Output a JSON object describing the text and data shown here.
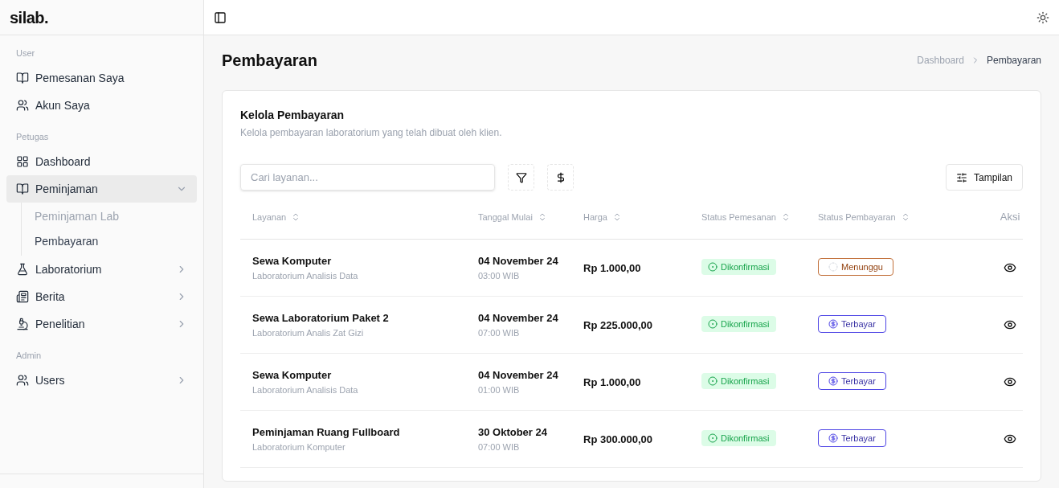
{
  "logo": "silab.",
  "sidebar": {
    "sections": [
      {
        "label": "User",
        "items": [
          {
            "label": "Pemesanan Saya",
            "selected": false
          },
          {
            "label": "Akun Saya",
            "selected": false
          }
        ]
      },
      {
        "label": "Petugas",
        "items": [
          {
            "label": "Dashboard",
            "selected": false
          },
          {
            "label": "Peminjaman",
            "selected": true,
            "expanded": true,
            "children": [
              {
                "label": "Peminjaman Lab",
                "selected": false
              },
              {
                "label": "Pembayaran",
                "selected": true
              }
            ]
          },
          {
            "label": "Laboratorium",
            "selected": false,
            "expanded": false
          },
          {
            "label": "Berita",
            "selected": false,
            "expanded": false
          },
          {
            "label": "Penelitian",
            "selected": false,
            "expanded": false
          }
        ]
      },
      {
        "label": "Admin",
        "items": [
          {
            "label": "Users",
            "selected": false,
            "expanded": false
          }
        ]
      }
    ]
  },
  "page": {
    "title": "Pembayaran",
    "breadcrumb": [
      {
        "label": "Dashboard",
        "selected": false
      },
      {
        "label": "Pembayaran",
        "selected": true
      }
    ]
  },
  "card": {
    "title": "Kelola Pembayaran",
    "subtitle": "Kelola pembayaran laboratorium yang telah dibuat oleh klien.",
    "search": {
      "placeholder": "Cari layanan..."
    },
    "view_button": "Tampilan"
  },
  "table": {
    "columns": [
      {
        "label": "Layanan",
        "sortable": true
      },
      {
        "label": "Tanggal Mulai",
        "sortable": true
      },
      {
        "label": "Harga",
        "sortable": true
      },
      {
        "label": "Status Pemesanan",
        "sortable": true
      },
      {
        "label": "Status Pembayaran",
        "sortable": true
      },
      {
        "label": "Aksi",
        "sortable": false
      }
    ],
    "rows": [
      {
        "service": "Sewa Komputer",
        "lab": "Laboratorium Analisis Data",
        "date": "04 November 24",
        "time": "03:00 WIB",
        "price": "Rp 1.000,00",
        "order_status": {
          "label": "Dikonfirmasi",
          "kind": "confirmed"
        },
        "payment_status": {
          "label": "Menunggu",
          "kind": "pending"
        }
      },
      {
        "service": "Sewa Laboratorium Paket 2",
        "lab": "Laboratorium Analis Zat Gizi",
        "date": "04 November 24",
        "time": "07:00 WIB",
        "price": "Rp 225.000,00",
        "order_status": {
          "label": "Dikonfirmasi",
          "kind": "confirmed"
        },
        "payment_status": {
          "label": "Terbayar",
          "kind": "paid"
        }
      },
      {
        "service": "Sewa Komputer",
        "lab": "Laboratorium Analisis Data",
        "date": "04 November 24",
        "time": "01:00 WIB",
        "price": "Rp 1.000,00",
        "order_status": {
          "label": "Dikonfirmasi",
          "kind": "confirmed"
        },
        "payment_status": {
          "label": "Terbayar",
          "kind": "paid"
        }
      },
      {
        "service": "Peminjaman Ruang Fullboard",
        "lab": "Laboratorium Komputer",
        "date": "30 Oktober 24",
        "time": "07:00 WIB",
        "price": "Rp 300.000,00",
        "order_status": {
          "label": "Dikonfirmasi",
          "kind": "confirmed"
        },
        "payment_status": {
          "label": "Terbayar",
          "kind": "paid"
        }
      }
    ]
  }
}
